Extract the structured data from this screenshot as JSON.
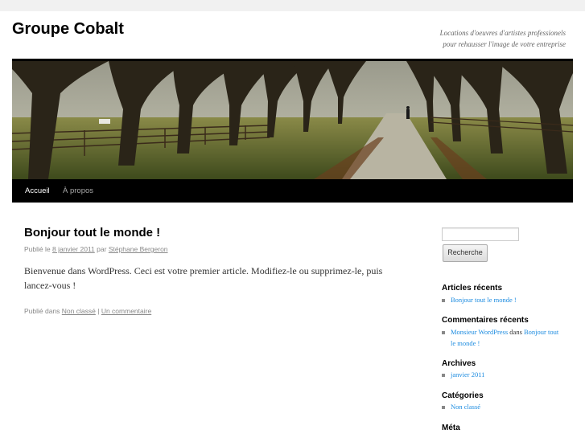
{
  "site": {
    "title": "Groupe Cobalt",
    "description_line1": "Locations d'oeuvres d'artistes professionels",
    "description_line2": "pour rehausser l'image de votre entreprise"
  },
  "nav": {
    "items": [
      {
        "label": "Accueil"
      },
      {
        "label": "À propos"
      }
    ]
  },
  "post": {
    "title": "Bonjour tout le monde !",
    "meta_published": "Publié le",
    "meta_date": "8 janvier 2011",
    "meta_by": "par",
    "meta_author": "Stéphane Bergeron",
    "body": "Bienvenue dans WordPress. Ceci est votre premier article. Modifiez-le ou supprimez-le, puis lancez-vous !",
    "footer_published_in": "Publié dans",
    "footer_category": "Non classé",
    "footer_sep": "|",
    "footer_comment": "Un commentaire"
  },
  "sidebar": {
    "search_value": "",
    "search_button": "Recherche",
    "recent_posts": {
      "title": "Articles récents",
      "items": [
        "Bonjour tout le monde !"
      ]
    },
    "recent_comments": {
      "title": "Commentaires récents",
      "author": "Monsieur WordPress",
      "connector": "dans",
      "post": "Bonjour tout le monde !"
    },
    "archives": {
      "title": "Archives",
      "items": [
        "janvier 2011"
      ]
    },
    "categories": {
      "title": "Catégories",
      "items": [
        "Non classé"
      ]
    },
    "meta": {
      "title": "Méta"
    }
  },
  "colors": {
    "link": "#1b8be0",
    "nav_bg": "#000000",
    "page_bg": "#f1f1f1"
  }
}
